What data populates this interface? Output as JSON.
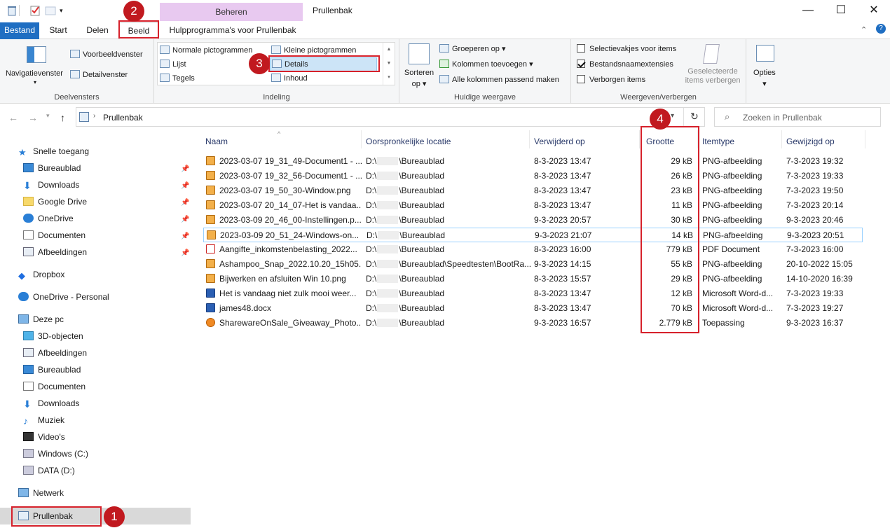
{
  "window": {
    "title": "Prullenbak",
    "contextual_tab_group": "Beheren",
    "controls": {
      "minimize": "—",
      "maximize": "☐",
      "close": "✕"
    }
  },
  "ribbon_tabs": [
    {
      "label": "Bestand"
    },
    {
      "label": "Start"
    },
    {
      "label": "Delen"
    },
    {
      "label": "Beeld"
    },
    {
      "label": "Hulpprogramma's voor Prullenbak"
    }
  ],
  "ribbon": {
    "deelvensters": {
      "label": "Deelvensters",
      "navigatievenster": "Navigatievenster",
      "voorbeeldvenster": "Voorbeeldvenster",
      "detailvenster": "Detailvenster"
    },
    "indeling": {
      "label": "Indeling",
      "items": [
        "Normale pictogrammen",
        "Kleine pictogrammen",
        "Lijst",
        "Details",
        "Tegels",
        "Inhoud"
      ]
    },
    "huidige_weergave": {
      "label": "Huidige weergave",
      "sorteren_line1": "Sorteren",
      "sorteren_line2": "op",
      "groeperen": "Groeperen op",
      "kolommen": "Kolommen toevoegen",
      "passend": "Alle kolommen passend maken"
    },
    "weergeven": {
      "label": "Weergeven/verbergen",
      "selectievakjes": {
        "label": "Selectievakjes voor items",
        "checked": false
      },
      "extensies": {
        "label": "Bestandsnaamextensies",
        "checked": true
      },
      "verborgen": {
        "label": "Verborgen items",
        "checked": false
      },
      "geselecteerde_line1": "Geselecteerde",
      "geselecteerde_line2": "items verbergen"
    },
    "opties": "Opties"
  },
  "address": {
    "path": "Prullenbak",
    "search_placeholder": "Zoeken in Prullenbak"
  },
  "nav": {
    "quick_access": "Snelle toegang",
    "quick_items": [
      "Bureaublad",
      "Downloads",
      "Google Drive",
      "OneDrive",
      "Documenten",
      "Afbeeldingen"
    ],
    "dropbox": "Dropbox",
    "onedrive_personal": "OneDrive - Personal",
    "this_pc": "Deze pc",
    "pc_items": [
      "3D-objecten",
      "Afbeeldingen",
      "Bureaublad",
      "Documenten",
      "Downloads",
      "Muziek",
      "Video's",
      "Windows (C:)",
      "DATA (D:)"
    ],
    "network": "Netwerk",
    "recycle": "Prullenbak"
  },
  "columns": [
    "Naam",
    "Oorspronkelijke locatie",
    "Verwijderd op",
    "Grootte",
    "Itemtype",
    "Gewijzigd op"
  ],
  "files": [
    {
      "name": "2023-03-07 19_31_49-Document1 - ...",
      "loc_prefix": "D:\\",
      "loc": "\\Bureaublad",
      "deleted": "8-3-2023 13:47",
      "size": "29 kB",
      "type": "PNG-afbeelding",
      "modified": "7-3-2023 19:32",
      "icon": "png"
    },
    {
      "name": "2023-03-07 19_32_56-Document1 - ...",
      "loc_prefix": "D:\\",
      "loc": "\\Bureaublad",
      "deleted": "8-3-2023 13:47",
      "size": "26 kB",
      "type": "PNG-afbeelding",
      "modified": "7-3-2023 19:33",
      "icon": "png"
    },
    {
      "name": "2023-03-07 19_50_30-Window.png",
      "loc_prefix": "D:\\",
      "loc": "\\Bureaublad",
      "deleted": "8-3-2023 13:47",
      "size": "23 kB",
      "type": "PNG-afbeelding",
      "modified": "7-3-2023 19:50",
      "icon": "png"
    },
    {
      "name": "2023-03-07 20_14_07-Het is vandaa...",
      "loc_prefix": "D:\\",
      "loc": "\\Bureaublad",
      "deleted": "8-3-2023 13:47",
      "size": "11 kB",
      "type": "PNG-afbeelding",
      "modified": "7-3-2023 20:14",
      "icon": "png"
    },
    {
      "name": "2023-03-09 20_46_00-Instellingen.p...",
      "loc_prefix": "D:\\",
      "loc": "\\Bureaublad",
      "deleted": "9-3-2023 20:57",
      "size": "30 kB",
      "type": "PNG-afbeelding",
      "modified": "9-3-2023 20:46",
      "icon": "png"
    },
    {
      "name": "2023-03-09 20_51_24-Windows-on...",
      "loc_prefix": "D:\\",
      "loc": "\\Bureaublad",
      "deleted": "9-3-2023 21:07",
      "size": "14 kB",
      "type": "PNG-afbeelding",
      "modified": "9-3-2023 20:51",
      "icon": "png",
      "selected": true
    },
    {
      "name": "Aangifte_inkomstenbelasting_2022...",
      "loc_prefix": "D:\\",
      "loc": "\\Bureaublad",
      "deleted": "8-3-2023 16:00",
      "size": "779 kB",
      "type": "PDF Document",
      "modified": "7-3-2023 16:00",
      "icon": "pdf"
    },
    {
      "name": "Ashampoo_Snap_2022.10.20_15h05...",
      "loc_prefix": "D:\\",
      "loc": "\\Bureaublad\\Speedtesten\\BootRa...",
      "deleted": "9-3-2023 14:15",
      "size": "55 kB",
      "type": "PNG-afbeelding",
      "modified": "20-10-2022 15:05",
      "icon": "png"
    },
    {
      "name": "Bijwerken en afsluiten Win 10.png",
      "loc_prefix": "D:\\",
      "loc": "\\Bureaublad",
      "deleted": "8-3-2023 15:57",
      "size": "29 kB",
      "type": "PNG-afbeelding",
      "modified": "14-10-2020 16:39",
      "icon": "png"
    },
    {
      "name": "Het is vandaag niet zulk mooi weer...",
      "loc_prefix": "D:\\",
      "loc": "\\Bureaublad",
      "deleted": "8-3-2023 13:47",
      "size": "12 kB",
      "type": "Microsoft Word-d...",
      "modified": "7-3-2023 19:33",
      "icon": "word"
    },
    {
      "name": "james48.docx",
      "loc_prefix": "D:\\",
      "loc": "\\Bureaublad",
      "deleted": "8-3-2023 13:47",
      "size": "70 kB",
      "type": "Microsoft Word-d...",
      "modified": "7-3-2023 19:27",
      "icon": "word"
    },
    {
      "name": "SharewareOnSale_Giveaway_Photo...",
      "loc_prefix": "D:\\",
      "loc": "\\Bureaublad",
      "deleted": "9-3-2023 16:57",
      "size": "2.779 kB",
      "type": "Toepassing",
      "modified": "9-3-2023 16:37",
      "icon": "exe"
    }
  ],
  "annotations": [
    "1",
    "2",
    "3",
    "4"
  ],
  "colors": {
    "accent": "#1f6ec2",
    "annotation_red": "#c1191f",
    "contextual_tab": "#e8c9f0"
  }
}
